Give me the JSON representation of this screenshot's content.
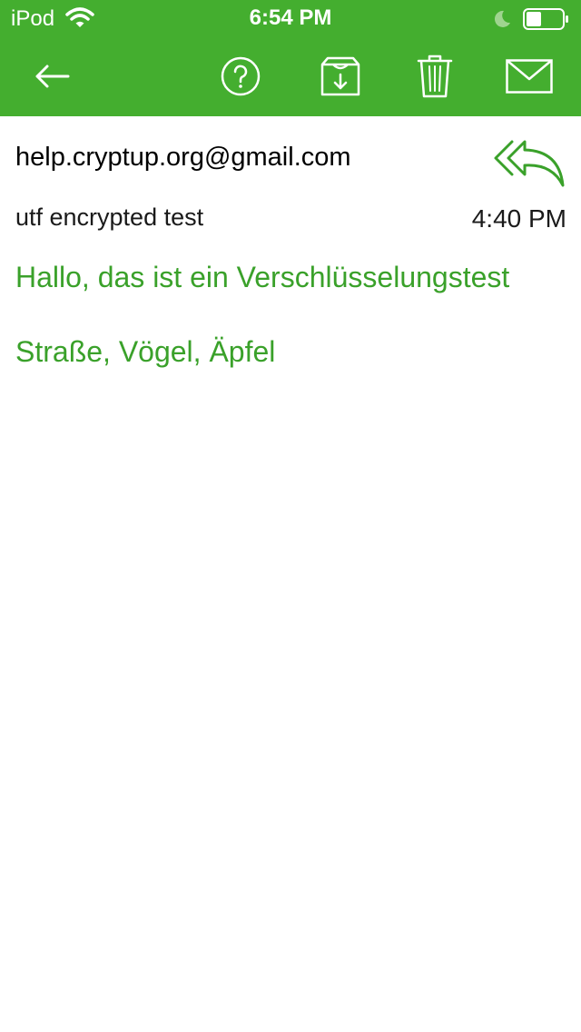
{
  "status_bar": {
    "carrier": "iPod",
    "time": "6:54 PM",
    "icons": [
      "wifi-icon",
      "do-not-disturb-moon-icon",
      "battery-icon"
    ]
  },
  "toolbar": {
    "background_color": "#44ae2f",
    "icon_color": "#ffffff",
    "buttons": [
      "back-arrow-icon",
      "help-icon",
      "archive-icon",
      "trash-icon",
      "mail-icon"
    ]
  },
  "message": {
    "sender": "help.cryptup.org@gmail.com",
    "subject": "utf encrypted test",
    "time": "4:40 PM",
    "reply_all_icon": "reply-all-icon",
    "body_color": "#3aa12a",
    "body_lines": [
      "Hallo, das ist ein Verschlüsselungstest",
      "Straße, Vögel, Äpfel"
    ]
  }
}
